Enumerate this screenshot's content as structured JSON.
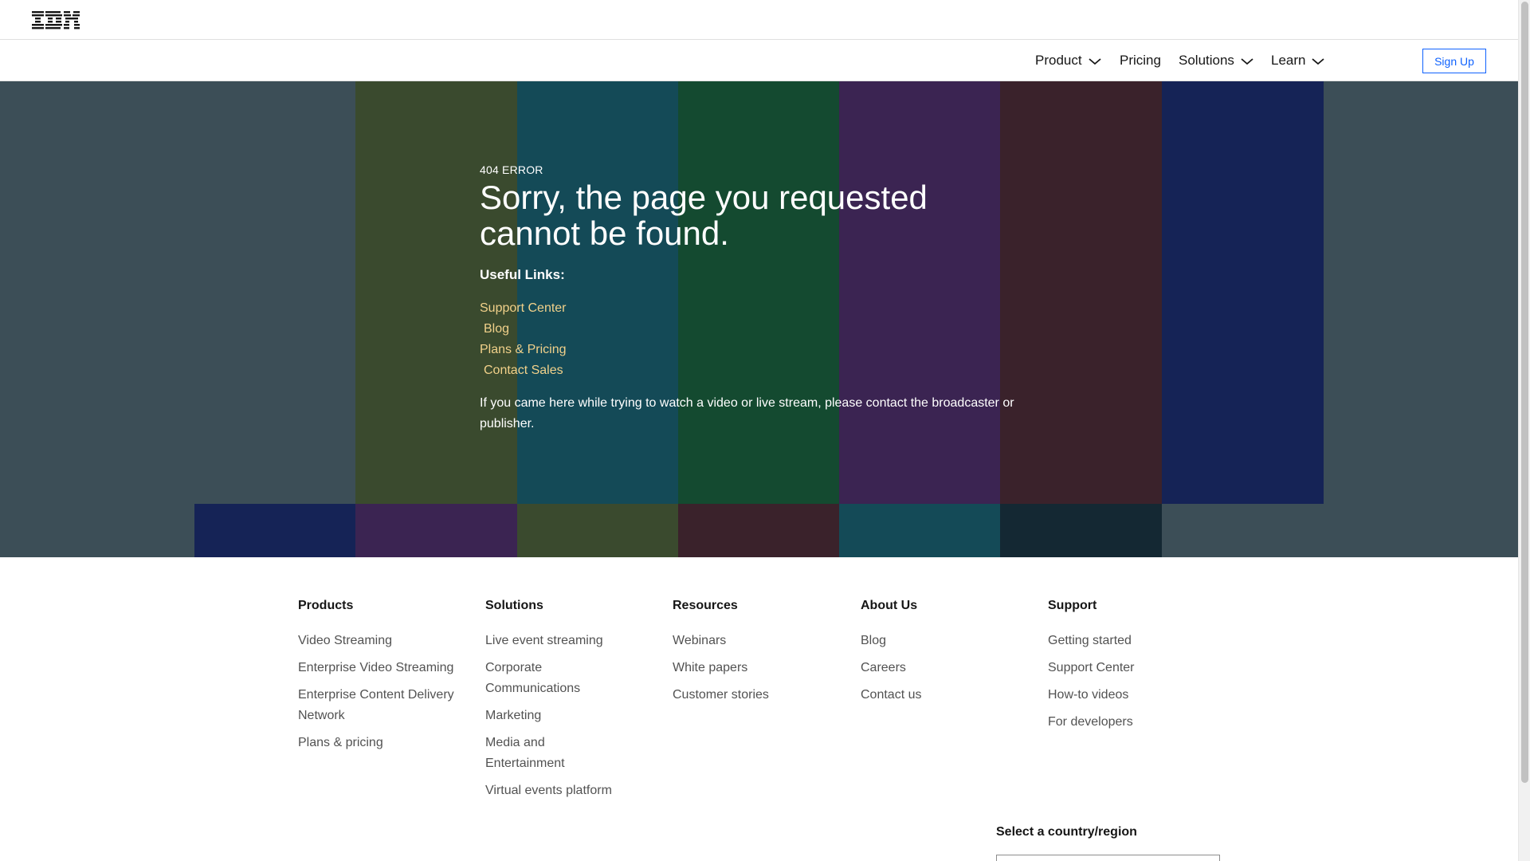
{
  "header": {
    "logo_text": "IBM"
  },
  "nav": {
    "items": [
      {
        "label": "Product",
        "has_dropdown": true
      },
      {
        "label": "Pricing",
        "has_dropdown": false
      },
      {
        "label": "Solutions",
        "has_dropdown": true
      },
      {
        "label": "Learn",
        "has_dropdown": true
      }
    ],
    "signup_label": "Sign Up"
  },
  "hero": {
    "error_code": "404 ERROR",
    "headline": "Sorry, the page you requested cannot be found.",
    "useful_links_title": "Useful Links:",
    "links": [
      "Support Center",
      "Blog",
      "Plans & Pricing",
      "Contact Sales"
    ],
    "note": "If you came here while trying to watch a video or live stream, please contact the broadcaster or publisher.",
    "colors": {
      "background": "#3c4e57",
      "link": "#f1d18a"
    }
  },
  "footer": {
    "columns": [
      {
        "title": "Products",
        "links": [
          "Video Streaming",
          "Enterprise Video Streaming",
          "Enterprise Content Delivery Network",
          "Plans & pricing"
        ]
      },
      {
        "title": "Solutions",
        "links": [
          "Live event streaming",
          "Corporate Communications",
          "Marketing",
          "Media and Entertainment",
          "Virtual events platform"
        ]
      },
      {
        "title": "Resources",
        "links": [
          "Webinars",
          "White papers",
          "Customer stories"
        ]
      },
      {
        "title": "About Us",
        "links": [
          "Blog",
          "Careers",
          "Contact us"
        ]
      },
      {
        "title": "Support",
        "links": [
          "Getting started",
          "Support Center",
          "How-to videos",
          "For developers"
        ]
      }
    ],
    "region_label": "Select a country/region"
  }
}
